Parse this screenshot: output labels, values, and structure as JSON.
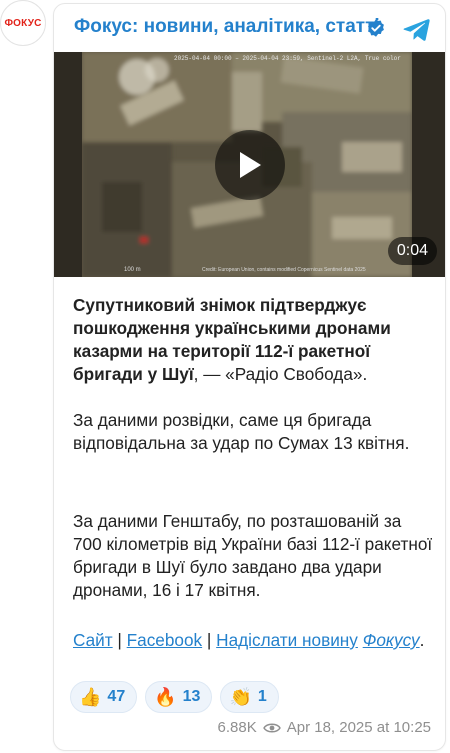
{
  "avatar": {
    "label": "ФОКУС"
  },
  "header": {
    "channel_name": "Фокус: новини, аналітика, статті",
    "verified_icon": "verified-badge-icon",
    "app_icon": "telegram-icon"
  },
  "video": {
    "duration": "0:04",
    "caption": "2025-04-04 00:00 – 2025-04-04 23:59, Sentinel-2 L2A, True color",
    "scale": "100 m",
    "credit": "Credit: European Union, contains modified Copernicus Sentinel data 2025"
  },
  "post": {
    "p1_bold": "Супутниковий знімок підтверджує пошкодження українськими дронами казарми на території 112-ї ракетної бригади у Шуї",
    "p1_rest": ", — «Радіо Свобода».",
    "p2": "За даними розвідки, саме ця бригада відповідальна за удар по Сумах 13 квітня.",
    "p3": "За даними Генштабу, по розташованій за 700 кілометрів від України базі 112-ї ракетної бригади в Шуї було завдано два удари дронами, 16 і 17 квітня.",
    "links": {
      "site": "Сайт",
      "sep1": " | ",
      "facebook": "Facebook",
      "sep2": " | ",
      "send_news": "Надіслати новину",
      "fokus": "Фокусу",
      "end": "."
    }
  },
  "reactions": [
    {
      "emoji": "👍",
      "count": "47"
    },
    {
      "emoji": "🔥",
      "count": "13"
    },
    {
      "emoji": "👏",
      "count": "1"
    }
  ],
  "meta": {
    "views": "6.88K",
    "date": "Apr 18, 2025 at 10:25"
  },
  "colors": {
    "accent": "#2481cc",
    "brand": "#e2231a",
    "text": "#222222",
    "muted": "#8f8f8f"
  }
}
